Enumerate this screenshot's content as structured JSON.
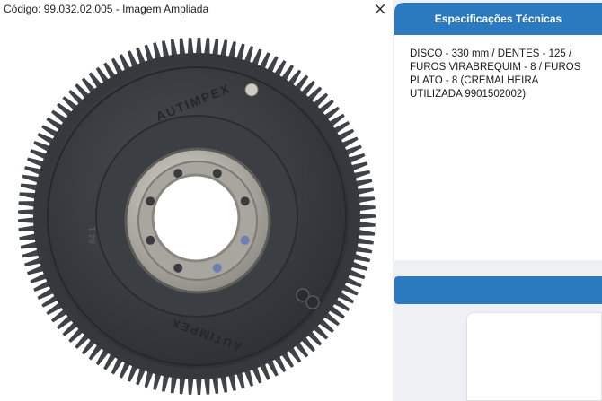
{
  "window": {
    "title": "Código: 99.032.02.005 - Imagem Ampliada",
    "close_glyph": "✕"
  },
  "product_image": {
    "brand_text": "AUTIMPEX",
    "stamp_text": "84 1"
  },
  "specs": {
    "header": "Especificações Técnicas",
    "description": "DISCO - 330 mm / DENTES - 125 / FUROS VIRABREQUIM - 8 / FUROS PLATO - 8 (CREMALHEIRA UTILIZADA 9901502002)"
  },
  "colors": {
    "accent": "#2b7ac0",
    "panel_bg": "#eef0f3",
    "ring_gear": "#3a3d42",
    "hub": "#b9b6b0"
  },
  "icons": {
    "close": "close-icon"
  }
}
